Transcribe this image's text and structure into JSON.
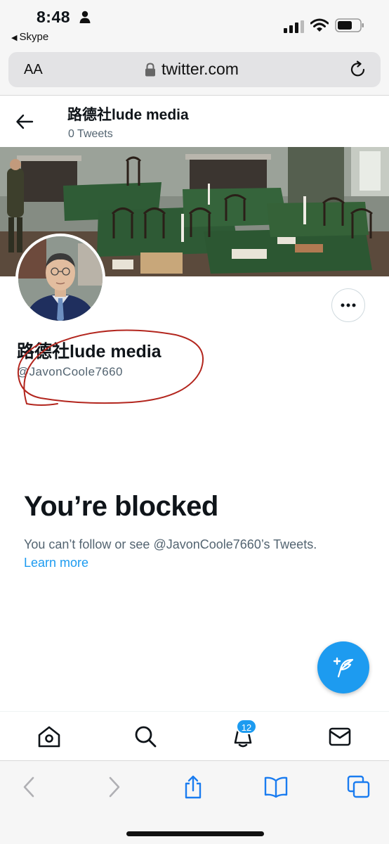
{
  "status_bar": {
    "time": "8:48",
    "back_app": "Skype",
    "icons": [
      "person-icon",
      "signal-icon",
      "wifi-icon",
      "battery-icon"
    ]
  },
  "safari": {
    "text_size_label": "AA",
    "url": "twitter.com",
    "icons": [
      "lock-icon",
      "reload-icon"
    ]
  },
  "header": {
    "name": "路德社lude media",
    "tweet_count": "0 Tweets"
  },
  "profile": {
    "name": "路德社lude media",
    "handle": "@JavonCoole7660"
  },
  "blocked": {
    "title": "You’re blocked",
    "description": "You can’t follow or see @JavonCoole7660’s Tweets.",
    "link": "Learn more"
  },
  "nav": {
    "notification_count": "12",
    "items": [
      "home-icon",
      "search-icon",
      "bell-icon",
      "mail-icon"
    ]
  },
  "safari_toolbar": {
    "items": [
      "back-icon",
      "forward-icon",
      "share-icon",
      "bookmarks-icon",
      "tabs-icon"
    ]
  },
  "colors": {
    "accent": "#1d9bf0",
    "text": "#0f1419",
    "secondary": "#536471",
    "annotation": "#b3261e"
  }
}
